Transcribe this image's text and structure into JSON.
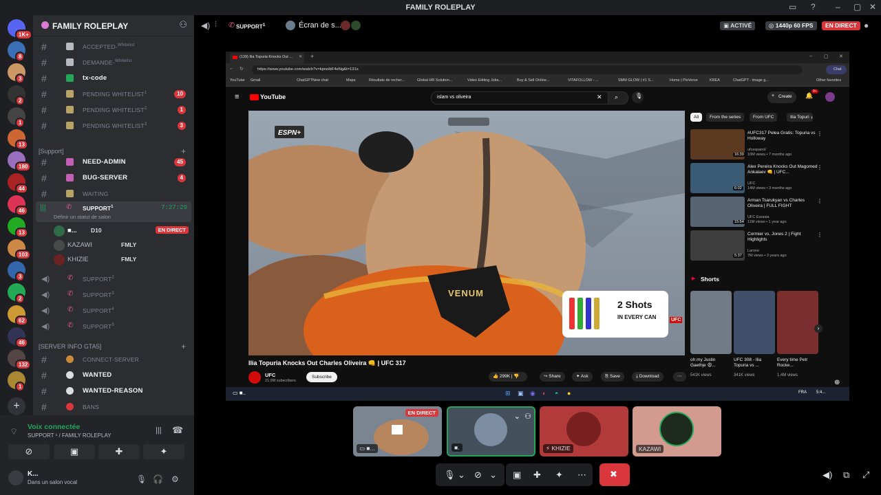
{
  "window": {
    "title": "FAMILY ROLEPLAY"
  },
  "rail": {
    "badges": [
      "1K+",
      "8",
      "3",
      "2",
      "1",
      "13",
      "180",
      "44",
      "46",
      "13",
      "103",
      "3",
      "2",
      "62",
      "46",
      "132",
      "1"
    ]
  },
  "server": {
    "name": "FAMILY ROLEPLAY"
  },
  "channels": [
    {
      "label": "ACCEPTED-",
      "sup": "Whitelist",
      "bold": false
    },
    {
      "label": "DEMANDE-",
      "sup": "Whitelist",
      "bold": false
    },
    {
      "label": "tx-code",
      "sup": "",
      "bold": true
    },
    {
      "label": "PENDING WHITELIST",
      "sup": "1",
      "bold": false,
      "count": "10"
    },
    {
      "label": "PENDING WHITELIST",
      "sup": "2",
      "bold": false,
      "count": "1"
    },
    {
      "label": "PENDING WHITELIST",
      "sup": "3",
      "bold": false,
      "count": "3"
    }
  ],
  "category_support": "[Support]",
  "support_channels": [
    {
      "label": "NEED-ADMIN",
      "bold": true,
      "count": "45"
    },
    {
      "label": "BUG-SERVER",
      "bold": true,
      "count": "4"
    },
    {
      "label": "WAITING",
      "bold": false
    }
  ],
  "active_voice": {
    "label": "SUPPORT",
    "sup": "1",
    "timer": "7:27:29",
    "status": "Définir un statut de salon"
  },
  "voice_users": [
    {
      "name": "■...",
      "tag": "D10",
      "live": "EN DIRECT"
    },
    {
      "name": "KAZAWI",
      "tag": "FMLY"
    },
    {
      "name": "KHIZIE",
      "tag": "FMLY"
    }
  ],
  "other_voice": [
    {
      "label": "SUPPORT",
      "sup": "2"
    },
    {
      "label": "SUPPORT",
      "sup": "3"
    },
    {
      "label": "SUPPORT",
      "sup": "4"
    },
    {
      "label": "SUPPORT",
      "sup": "5"
    }
  ],
  "category_info": "[SERVER INFO GTA5]",
  "info_channels": [
    {
      "label": "CONNECT-SERVER",
      "bold": false
    },
    {
      "label": "WANTED",
      "bold": true
    },
    {
      "label": "WANTED-REASON",
      "bold": true
    },
    {
      "label": "BANS",
      "bold": false
    }
  ],
  "voice_panel": {
    "status": "Voix connectée",
    "location": "SUPPORT ¹ / FAMILY ROLEPLAY",
    "user": "K...",
    "user_status": "Dans un salon vocal"
  },
  "stage_top": {
    "channel": "SUPPORT",
    "sup": "1",
    "stream": "Écran de s...",
    "activated": "ACTIVÉ",
    "quality": "1440p 60 FPS",
    "live": "EN DIRECT"
  },
  "browser": {
    "tab": "(139) Ilia Topuria Knocks Out ...",
    "url": "https://www.youtube.com/watch?v=kpnoibF4eNg&t=131s",
    "bookmarks": [
      "YouTube",
      "Gmail",
      "ChatGPTNew chat",
      "Maps",
      "Résultats de recher...",
      "Global HR Solution...",
      "Video Editing Jobs...",
      "Buy & Sell Online...",
      "VITAFOLLOW - ...",
      "SMM GLOW | #1 S...",
      "Home | PixVerse",
      "KREA",
      "ChatGPT - image g...",
      "Other favorites"
    ],
    "search": "islam vs oliveira",
    "create": "Create",
    "bell": "9+",
    "chat": "Chat"
  },
  "video": {
    "title": "Ilia Topuria Knocks Out Charles Oliveira 👊 | UFC 317",
    "channel": "UFC",
    "subs": "21.9M subscribers",
    "subscribe": "Subscribe",
    "likes": "299K",
    "share": "Share",
    "ask": "Ask",
    "save": "Save",
    "download": "Download",
    "ad_line1": "2 Shots",
    "ad_line2": "IN EVERY CAN",
    "ufc": "UFC",
    "brand": "VENUM",
    "broadcaster": "ESPN+"
  },
  "filters": [
    "All",
    "From the series",
    "From UFC",
    "Ilia Topuri"
  ],
  "related": [
    {
      "title": "#UFC317 Pelea Gratis: Topuria vs Holloway",
      "channel": "ufcespanol",
      "meta": "10M views • 7 months ago",
      "dur": "16:39",
      "color": "#5c3a22"
    },
    {
      "title": "Alex Pereira Knocks Out Magomed Ankalaev 👊 | UFC...",
      "channel": "UFC",
      "meta": "14M views • 3 months ago",
      "dur": "6:02",
      "color": "#3b5a74"
    },
    {
      "title": "Arman Tsarukyan vs Charles Oliveira | FULL FIGHT",
      "channel": "UFC Eurasia",
      "meta": "11M views • 1 year ago",
      "dur": "15:54",
      "color": "#556372"
    },
    {
      "title": "Cormier vs. Jones 2 | Fight Highlights",
      "channel": "Larone",
      "meta": "7M views • 3 years ago",
      "dur": "5:37",
      "color": "#3d3d3d"
    }
  ],
  "shorts_header": "Shorts",
  "shorts": [
    {
      "title": "oh my Justin Gaethje 😩...",
      "views": "541K views",
      "color": "#707b86"
    },
    {
      "title": "UFC 308 - Ilia Topuria vs ...",
      "views": "341K views",
      "color": "#41506a"
    },
    {
      "title": "Every time Petr Rocke...",
      "views": "1.4M views",
      "color": "#7a2e2e"
    }
  ],
  "taskbar": {
    "lang": "FRA",
    "time": "5:4..."
  },
  "tiles": [
    {
      "label": "■...",
      "live": "EN DIRECT"
    },
    {
      "label": "■."
    },
    {
      "label": "KHIZIE"
    },
    {
      "label": "KAZAWI"
    }
  ]
}
